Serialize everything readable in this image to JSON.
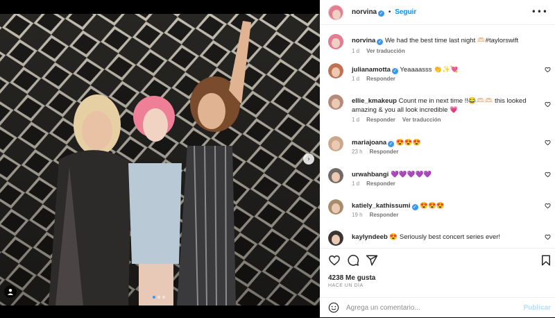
{
  "post": {
    "author": "norvina",
    "follow_label": "Seguir",
    "more_icon": "•••",
    "next_icon": "›",
    "likes": "4238 Me gusta",
    "date": "HACE UN DÍA",
    "carousel": {
      "count": 3,
      "active": 1
    }
  },
  "caption": {
    "username": "norvina",
    "text": "We had the best time last night 🫶🏻#taylorswift",
    "time": "1 d",
    "translate": "Ver traducción"
  },
  "comments": [
    {
      "username": "julianamotta",
      "verified": true,
      "text": "Yeaaaasss 👏✨💘",
      "time": "1 d",
      "reply": "Responder",
      "translate": "",
      "avatar_color": "#c0714f"
    },
    {
      "username": "ellie_kmakeup",
      "verified": false,
      "text": "Count me in next time !!😂🫶🏻🫶🏻 this looked amazing & you all look incredible 💗",
      "time": "1 d",
      "reply": "Responder",
      "translate": "Ver traducción",
      "avatar_color": "#b48a7a"
    },
    {
      "username": "mariajoana",
      "verified": true,
      "text": "😍😍😍",
      "time": "23 h",
      "reply": "Responder",
      "translate": "",
      "avatar_color": "#c9a98a"
    },
    {
      "username": "urwahbangi",
      "verified": false,
      "text": "💜💜💜💜💜",
      "time": "1 d",
      "reply": "Responder",
      "translate": "",
      "avatar_color": "#6f6a66"
    },
    {
      "username": "katiely_kathissumi",
      "verified": true,
      "text": "😍😍😍",
      "time": "19 h",
      "reply": "Responder",
      "translate": "",
      "avatar_color": "#a88c6c"
    },
    {
      "username": "kaylyndeeb",
      "verified": false,
      "text": "😍 Seriously best concert series ever!",
      "time": "",
      "reply": "",
      "translate": "",
      "avatar_color": "#3a3433"
    }
  ],
  "composer": {
    "placeholder": "Agrega un comentario...",
    "publish_label": "Publicar"
  },
  "colors": {
    "accent": "#0095f6",
    "verified": "#3897f0",
    "secondary_text": "#8e8e8e"
  }
}
